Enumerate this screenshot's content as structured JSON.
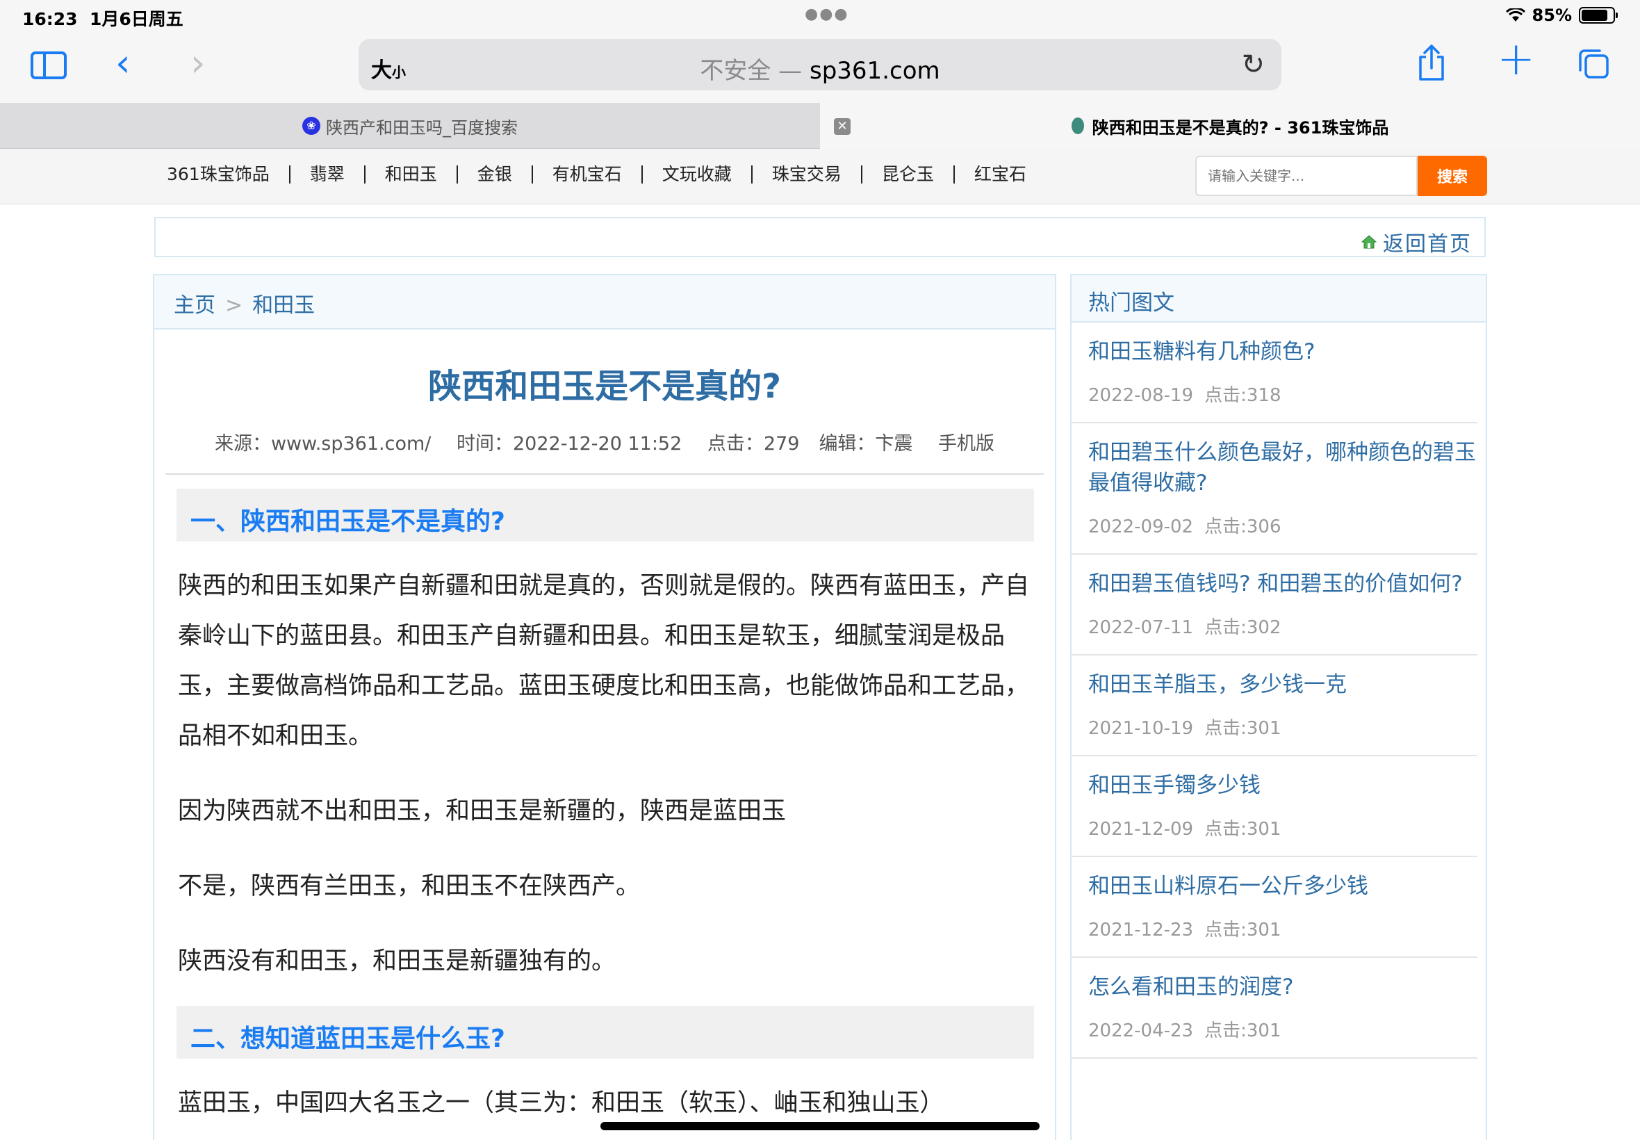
{
  "status": {
    "time": "16:23",
    "date": "1月6日周五",
    "battery": "85%",
    "battery_level": 0.85
  },
  "browser": {
    "size_label": "大",
    "size_small": "小",
    "insecure": "不安全 —",
    "domain": "sp361.com",
    "tabs": [
      {
        "label": "陕西产和田玉吗_百度搜索"
      },
      {
        "label": "陕西和田玉是不是真的? - 361珠宝饰品"
      }
    ]
  },
  "nav": {
    "items": [
      "361珠宝饰品",
      "翡翠",
      "和田玉",
      "金银",
      "有机宝石",
      "文玩收藏",
      "珠宝交易",
      "昆仑玉",
      "红宝石"
    ],
    "search_placeholder": "请输入关键字...",
    "search_button": "搜索"
  },
  "home_link": "返回首页",
  "breadcrumb": {
    "home": "主页",
    "sep": ">",
    "current": "和田玉"
  },
  "article": {
    "title": "陕西和田玉是不是真的?",
    "meta": {
      "source": "来源：www.sp361.com/",
      "time": "时间：2022-12-20 11:52",
      "clicks": "点击：279",
      "editor": "编辑：卞震",
      "mobile": "手机版"
    },
    "section1": "一、陕西和田玉是不是真的?",
    "p1": "陕西的和田玉如果产自新疆和田就是真的，否则就是假的。陕西有蓝田玉，产自秦岭山下的蓝田县。和田玉产自新疆和田县。和田玉是软玉，细腻莹润是极品玉，主要做高档饰品和工艺品。蓝田玉硬度比和田玉高，也能做饰品和工艺品，品相不如和田玉。",
    "p2": "因为陕西就不出和田玉，和田玉是新疆的，陕西是蓝田玉",
    "p3": "不是，陕西有兰田玉，和田玉不在陕西产。",
    "p4": "陕西没有和田玉，和田玉是新疆独有的。",
    "section2": "二、想知道蓝田玉是什么玉?",
    "p5": "蓝田玉，中国四大名玉之一（其三为：和田玉（软玉）、岫玉和独山玉）"
  },
  "sidebar": {
    "heading": "热门图文",
    "items": [
      {
        "title": "和田玉糖料有几种颜色?",
        "date": "2022-08-19",
        "clicks": "点击:318"
      },
      {
        "title": "和田碧玉什么颜色最好，哪种颜色的碧玉最值得收藏?",
        "date": "2022-09-02",
        "clicks": "点击:306"
      },
      {
        "title": "和田碧玉值钱吗? 和田碧玉的价值如何?",
        "date": "2022-07-11",
        "clicks": "点击:302"
      },
      {
        "title": "和田玉羊脂玉，多少钱一克",
        "date": "2021-10-19",
        "clicks": "点击:301"
      },
      {
        "title": "和田玉手镯多少钱",
        "date": "2021-12-09",
        "clicks": "点击:301"
      },
      {
        "title": "和田玉山料原石一公斤多少钱",
        "date": "2021-12-23",
        "clicks": "点击:301"
      },
      {
        "title": "怎么看和田玉的润度?",
        "date": "2022-04-23",
        "clicks": "点击:301"
      }
    ]
  },
  "colors": {
    "link": "#2e6da4",
    "accent": "#1a7cf2",
    "search_button": "#ff6a00"
  },
  "icons": [
    "sidebar-icon",
    "back-icon",
    "forward-icon",
    "reload-icon",
    "share-icon",
    "plus-icon",
    "tabs-icon",
    "close-icon",
    "home-icon",
    "wifi-icon",
    "battery-icon"
  ]
}
